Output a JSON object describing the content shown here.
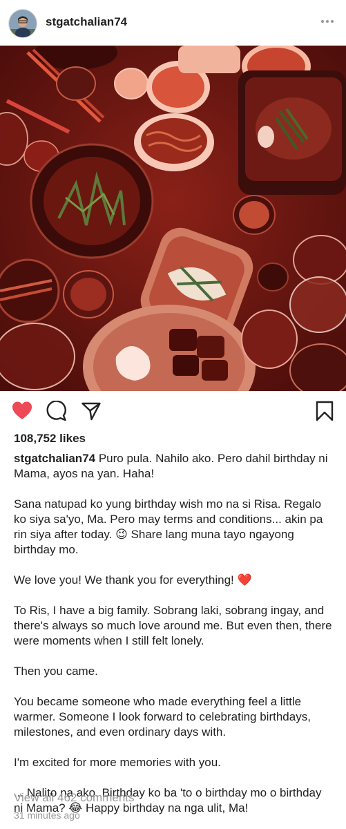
{
  "header": {
    "username": "stgatchalian74",
    "avatar_icon": "user-avatar",
    "more_icon": "more-options-icon"
  },
  "post": {
    "photo_description_icon": "food-photo",
    "likes": "108,752 likes",
    "caption": {
      "author": "stgatchalian74",
      "p1": "Puro pula. Nahilo ako. Pero dahil birthday ni Mama, ayos na yan. Haha!",
      "p2": "Sana natupad ko yung birthday wish mo na si Risa. Regalo ko siya sa'yo, Ma. Pero may terms and conditions... akin pa rin siya after today.",
      "p2_emoji": "😉",
      "p2_tail": "Share lang muna tayo ngayong birthday mo.",
      "p3": "We love you! We thank you for everything!",
      "p3_emoji": "❤️",
      "p4": "To Ris, I have a big family. Sobrang laki, sobrang ingay, and there's always so much love around me. But even then, there were moments when I still felt lonely.",
      "p5": "Then you came.",
      "p6": "You became someone who made everything feel a little warmer. Someone I look forward to celebrating birthdays, milestones, and even ordinary days with.",
      "p7": "I'm excited for more memories with you.",
      "p8": "... Nalito na ako. Birthday ko ba 'to o birthday mo o birthday ni Mama?",
      "p8_emoji": "😂",
      "p8_tail": "Happy birthday na nga ulit, Ma!"
    },
    "view_comments": "View all 462 comments",
    "timestamp": "31 minutes ago"
  },
  "colors": {
    "like_red": "#ed4956",
    "text": "#222222",
    "muted": "#999999"
  }
}
